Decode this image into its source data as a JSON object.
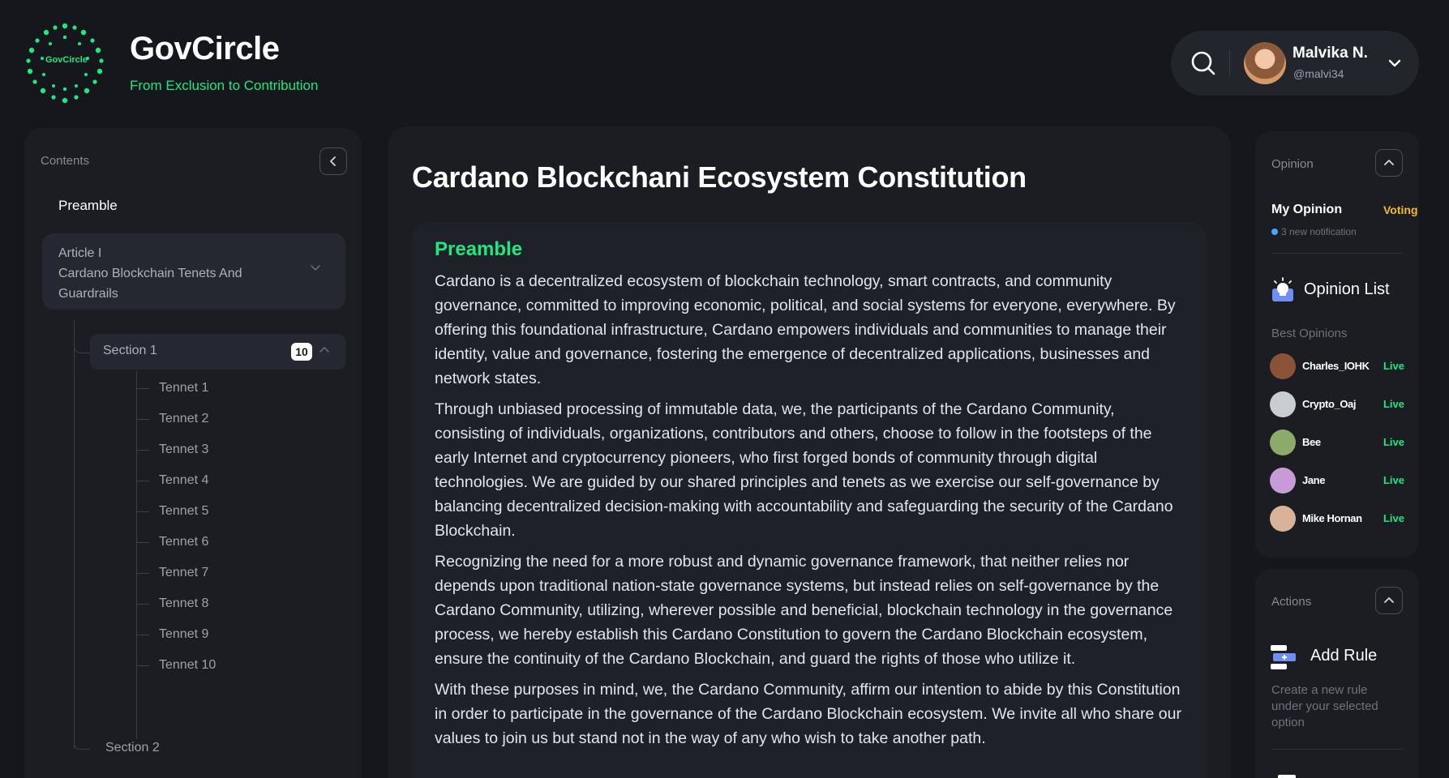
{
  "brand": {
    "logo_text": "GovCircle",
    "name": "GovCircle",
    "tagline": "From Exclusion to Contribution",
    "accent_color": "#1ee87e"
  },
  "user": {
    "name": "Malvika N.",
    "handle": "@malvi34"
  },
  "icons": {
    "search": "search-icon",
    "dropdown": "chevron-down-icon",
    "collapse": "chevron-left-icon"
  },
  "contents": {
    "label": "Contents",
    "preamble": "Preamble",
    "article": {
      "title": "Article I",
      "subtitle": "Cardano Blockchain Tenets And Guardrails"
    },
    "section1": {
      "label": "Section 1",
      "badge": "10",
      "tennets": [
        "Tennet 1",
        "Tennet 2",
        "Tennet 3",
        "Tennet 4",
        "Tennet 5",
        "Tennet 6",
        "Tennet 7",
        "Tennet 8",
        "Tennet 9",
        "Tennet 10"
      ]
    },
    "section2": "Section 2"
  },
  "document": {
    "title": "Cardano Blockchani Ecosystem Constitution",
    "heading": "Preamble",
    "paragraphs": [
      "Cardano is a decentralized ecosystem of blockchain technology, smart contracts, and community governance, committed to improving economic, political, and social systems for everyone, everywhere. By offering this foundational infrastructure, Cardano empowers individuals and communities to manage their identity, value and governance, fostering the emergence of decentralized applications, businesses and network states.",
      "Through unbiased processing of immutable data, we, the participants of the Cardano Community, consisting of individuals, organizations, contributors and others, choose to follow in the footsteps of the early Internet and cryptocurrency pioneers, who first forged bonds of community through digital technologies. We are guided by our shared principles and tenets as we exercise our self-governance by balancing decentralized decision-making with accountability and safeguarding the security of the Cardano Blockchain.",
      "Recognizing the need for a more robust and dynamic governance framework, that neither relies nor depends upon traditional nation-state governance systems, but instead relies on self-governance by the Cardano Community, utilizing, wherever possible and beneficial, blockchain technology in the governance process, we hereby establish this Cardano Constitution to govern the Cardano Blockchain ecosystem, ensure the continuity of the Cardano Blockchain, and guard the rights of those who utilize it.",
      "With these purposes in mind, we, the Cardano Community, affirm our intention to abide by this Constitution in order to participate in the governance of the Cardano Blockchain ecosystem. We invite all who share our values to join us but stand not in the way of any who wish to take another path."
    ]
  },
  "opinion": {
    "label": "Opinion",
    "my_opinion": "My Opinion",
    "status": "Voting",
    "status_color": "#f7b928",
    "notification": "3 new notification",
    "list_label": "Opinion List",
    "best_label": "Best Opinions",
    "people": [
      {
        "name": "Charles_IOHK",
        "status": "Live",
        "avatar_color": "#8a5236"
      },
      {
        "name": "Crypto_Oaj",
        "status": "Live",
        "avatar_color": "#c9ccd2"
      },
      {
        "name": "Bee",
        "status": "Live",
        "avatar_color": "#8cab6a"
      },
      {
        "name": "Jane",
        "status": "Live",
        "avatar_color": "#c79bd8"
      },
      {
        "name": "Mike Hornan",
        "status": "Live",
        "avatar_color": "#d8b39a"
      }
    ]
  },
  "actions": {
    "label": "Actions",
    "add_rule": "Add Rule",
    "add_rule_desc": "Create a new rule under your selected option"
  }
}
